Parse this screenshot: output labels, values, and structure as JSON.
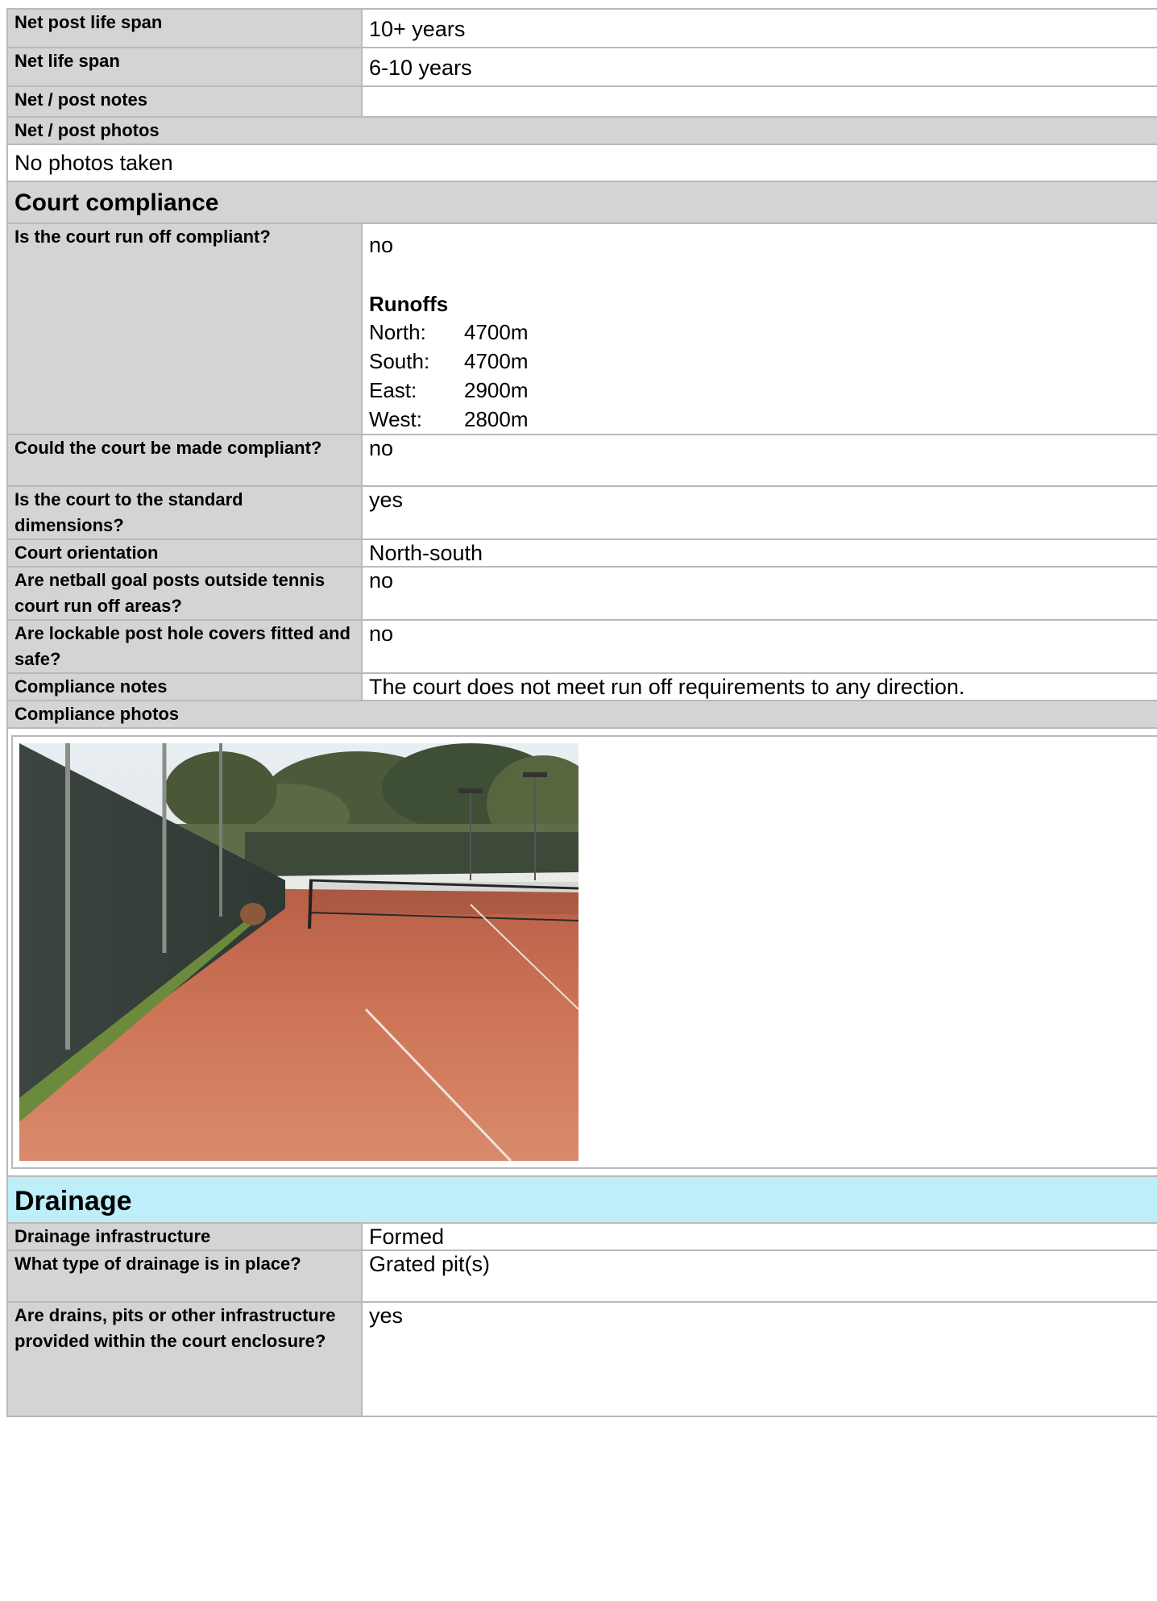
{
  "net": {
    "post_life_span": {
      "label": "Net post life span",
      "value": "10+ years"
    },
    "life_span": {
      "label": "Net life span",
      "value": "6-10 years"
    },
    "notes": {
      "label": "Net / post notes",
      "value": ""
    },
    "photos": {
      "label": "Net / post photos",
      "value": "No photos taken"
    }
  },
  "compliance": {
    "heading": "Court compliance",
    "run_off": {
      "label": "Is the court run off compliant?",
      "value": "no",
      "runoffs_title": "Runoffs",
      "runoffs": [
        {
          "dir": "North:",
          "val": "4700m"
        },
        {
          "dir": "South:",
          "val": "4700m"
        },
        {
          "dir": "East:",
          "val": "2900m"
        },
        {
          "dir": "West:",
          "val": "2800m"
        }
      ]
    },
    "made_compliant": {
      "label": "Could the court be made compliant?",
      "value": "no"
    },
    "standard_dimensions": {
      "label": "Is the court to the standard dimensions?",
      "value": "yes"
    },
    "orientation": {
      "label": "Court orientation",
      "value": "North-south"
    },
    "netball_posts": {
      "label": "Are netball goal posts outside tennis court run off areas?",
      "value": "no"
    },
    "post_hole_covers": {
      "label": "Are lockable post hole covers fitted and safe?",
      "value": "no"
    },
    "notes": {
      "label": "Compliance notes",
      "value": "The court does not meet run off requirements to any direction."
    },
    "photos": {
      "label": "Compliance photos"
    }
  },
  "drainage": {
    "heading": "Drainage",
    "infrastructure": {
      "label": "Drainage infrastructure",
      "value": "Formed"
    },
    "type": {
      "label": "What type of drainage is in place?",
      "value": "Grated pit(s)"
    },
    "within_enclosure": {
      "label": "Are drains, pits or other infrastructure provided within the court enclosure?",
      "value": "yes"
    }
  },
  "colors": {
    "label_bg": "#d4d4d4",
    "border": "#b9b9b9",
    "drainage_header_bg": "#bdeef9",
    "court_clay": "#c56a4c"
  }
}
